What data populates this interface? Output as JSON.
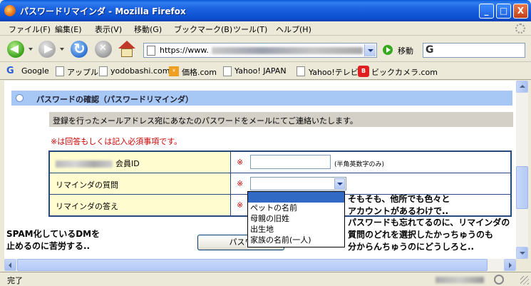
{
  "window": {
    "title": "パスワードリマインダ - Mozilla Firefox",
    "buttons": {
      "minimize": "_",
      "maximize": "□",
      "close": "X"
    }
  },
  "menu": [
    "ファイル(F)",
    "編集(E)",
    "表示(V)",
    "移動(G)",
    "ブックマーク(B)",
    "ツール(T)",
    "ヘルプ(H)"
  ],
  "toolbar": {
    "url": "https://www.",
    "go_label": "移動",
    "search_engine_icon": "google-icon"
  },
  "bookmarks": [
    "Google",
    "アップル",
    "yodobashi.com",
    "価格.com",
    "Yahoo! JAPAN",
    "Yahoo!テレビ",
    "ビックカメラ.com"
  ],
  "page": {
    "section_title": "パスワードの確認（パスワードリマインダ）",
    "info_text": "登録を行ったメールアドレス宛にあなたのパスワードをメールにてご連絡いたします。",
    "required_note": "※は回答もしくは記入必須事項です。",
    "form": {
      "member_id_label": "会員ID",
      "member_id_value": "",
      "member_id_hint": "(半角英数字のみ)",
      "question_label": "リマインダの質問",
      "answer_label": "リマインダの答え",
      "required_mark": "※",
      "question_selected": "",
      "question_options": [
        "",
        "ペットの名前",
        "母親の旧姓",
        "出生地",
        "家族の名前(一人)"
      ]
    },
    "submit_label": "パスワ"
  },
  "annotations": {
    "a1": [
      "そもそも、他所でも色々と",
      "アカウントがあるわけで.."
    ],
    "a2": [
      "パスワードも忘れてるのに、リマインダの",
      "質問のどれを選択したかっちゅうのも",
      "分からんちゅうのにどうしろと.."
    ],
    "a3": [
      "SPAM化しているDMを",
      "止めるのに苦労する.."
    ]
  },
  "status": {
    "text": "完了"
  },
  "colors": {
    "titlebar": "#0a4fcf",
    "section_bar": "#a7c8f5",
    "label_cell": "#fffdd0",
    "required": "#cc0000",
    "table_border": "#27497e",
    "selection": "#316ac5"
  }
}
